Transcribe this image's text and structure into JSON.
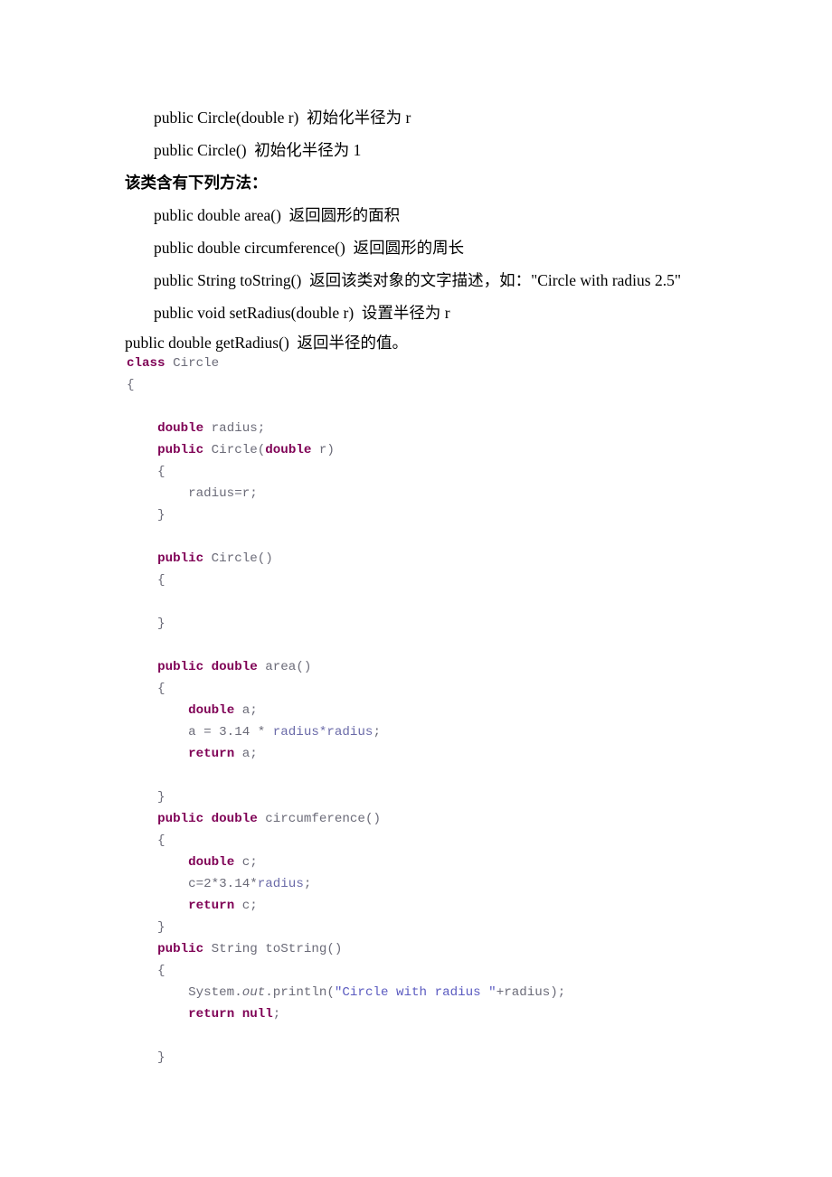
{
  "document": {
    "prose": [
      {
        "id": "ctor-double",
        "style": "indent",
        "text": "public Circle(double r)  初始化半径为 r"
      },
      {
        "id": "ctor-default",
        "style": "indent",
        "text": "public Circle()  初始化半径为 1"
      },
      {
        "id": "methods-heading",
        "style": "heading",
        "text": "该类含有下列方法："
      },
      {
        "id": "m-area",
        "style": "indent",
        "text": "public double area()  返回圆形的面积"
      },
      {
        "id": "m-circumference",
        "style": "indent",
        "text": "public double circumference()  返回圆形的周长"
      },
      {
        "id": "m-tostring",
        "style": "indent",
        "text": "public String toString()  返回该类对象的文字描述，如：\"Circle with radius 2.5\""
      },
      {
        "id": "m-setradius",
        "style": "indent",
        "text": "public void setRadius(double r)  设置半径为 r"
      },
      {
        "id": "m-getradius",
        "style": "flush",
        "text": "public double getRadius()  返回半径的值。"
      }
    ],
    "code": {
      "language": "java",
      "colors": {
        "keyword": "#7f0055",
        "identifier": "#6b6b78",
        "field": "#6a6aa8",
        "string": "#5b5bc0"
      },
      "lines": [
        [
          {
            "t": "class",
            "c": "kw"
          },
          {
            "t": " Circle",
            "c": "id"
          }
        ],
        [
          {
            "t": "{",
            "c": "id"
          }
        ],
        [
          {
            "t": "",
            "c": "id"
          }
        ],
        [
          {
            "t": "    ",
            "c": "id"
          },
          {
            "t": "double",
            "c": "kw"
          },
          {
            "t": " radius;",
            "c": "id"
          }
        ],
        [
          {
            "t": "    ",
            "c": "id"
          },
          {
            "t": "public",
            "c": "kw"
          },
          {
            "t": " Circle(",
            "c": "id"
          },
          {
            "t": "double",
            "c": "kw"
          },
          {
            "t": " r)",
            "c": "id"
          }
        ],
        [
          {
            "t": "    {",
            "c": "id"
          }
        ],
        [
          {
            "t": "        radius=r;",
            "c": "id"
          }
        ],
        [
          {
            "t": "    }",
            "c": "id"
          }
        ],
        [
          {
            "t": "",
            "c": "id"
          }
        ],
        [
          {
            "t": "    ",
            "c": "id"
          },
          {
            "t": "public",
            "c": "kw"
          },
          {
            "t": " Circle()",
            "c": "id"
          }
        ],
        [
          {
            "t": "    {",
            "c": "id"
          }
        ],
        [
          {
            "t": "",
            "c": "id"
          }
        ],
        [
          {
            "t": "    }",
            "c": "id"
          }
        ],
        [
          {
            "t": "",
            "c": "id"
          }
        ],
        [
          {
            "t": "    ",
            "c": "id"
          },
          {
            "t": "public double",
            "c": "kw"
          },
          {
            "t": " area()",
            "c": "id"
          }
        ],
        [
          {
            "t": "    {",
            "c": "id"
          }
        ],
        [
          {
            "t": "        ",
            "c": "id"
          },
          {
            "t": "double",
            "c": "kw"
          },
          {
            "t": " a;",
            "c": "id"
          }
        ],
        [
          {
            "t": "        a = 3.14 * ",
            "c": "id"
          },
          {
            "t": "radius*radius",
            "c": "fld"
          },
          {
            "t": ";",
            "c": "id"
          }
        ],
        [
          {
            "t": "        ",
            "c": "id"
          },
          {
            "t": "return",
            "c": "kw"
          },
          {
            "t": " a;",
            "c": "id"
          }
        ],
        [
          {
            "t": "",
            "c": "id"
          }
        ],
        [
          {
            "t": "    }",
            "c": "id"
          }
        ],
        [
          {
            "t": "    ",
            "c": "id"
          },
          {
            "t": "public double",
            "c": "kw"
          },
          {
            "t": " circumference()",
            "c": "id"
          }
        ],
        [
          {
            "t": "    {",
            "c": "id"
          }
        ],
        [
          {
            "t": "        ",
            "c": "id"
          },
          {
            "t": "double",
            "c": "kw"
          },
          {
            "t": " c;",
            "c": "id"
          }
        ],
        [
          {
            "t": "        c=2*3.14*",
            "c": "id"
          },
          {
            "t": "radius",
            "c": "fld"
          },
          {
            "t": ";",
            "c": "id"
          }
        ],
        [
          {
            "t": "        ",
            "c": "id"
          },
          {
            "t": "return",
            "c": "kw"
          },
          {
            "t": " c;",
            "c": "id"
          }
        ],
        [
          {
            "t": "    }",
            "c": "id"
          }
        ],
        [
          {
            "t": "    ",
            "c": "id"
          },
          {
            "t": "public",
            "c": "kw"
          },
          {
            "t": " String toString()",
            "c": "id"
          }
        ],
        [
          {
            "t": "    {",
            "c": "id"
          }
        ],
        [
          {
            "t": "        System.",
            "c": "id"
          },
          {
            "t": "out",
            "c": "ital"
          },
          {
            "t": ".println(",
            "c": "id"
          },
          {
            "t": "\"Circle with radius \"",
            "c": "str"
          },
          {
            "t": "+radius);",
            "c": "id"
          }
        ],
        [
          {
            "t": "        ",
            "c": "id"
          },
          {
            "t": "return null",
            "c": "kw"
          },
          {
            "t": ";",
            "c": "id"
          }
        ],
        [
          {
            "t": "",
            "c": "id"
          }
        ],
        [
          {
            "t": "    }",
            "c": "id"
          }
        ]
      ]
    }
  }
}
